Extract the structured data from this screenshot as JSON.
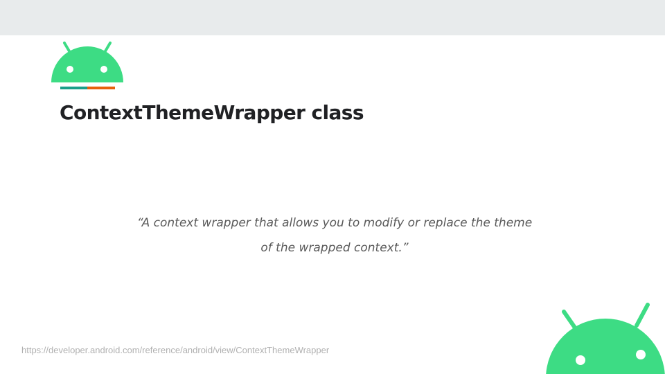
{
  "slide": {
    "title": "ContextThemeWrapper class",
    "quote_line1": "“A context wrapper that allows you to modify or replace the theme",
    "quote_line2": "of the wrapped context.”",
    "source_url": "https://developer.android.com/reference/android/view/ContextThemeWrapper"
  },
  "icons": {
    "top_logo": "android-head-icon",
    "corner_logo": "android-head-icon"
  },
  "colors": {
    "android_green": "#3ddc84",
    "bar_teal": "#1a9e8a",
    "bar_orange": "#e8600c",
    "top_band": "#e8ebec"
  }
}
